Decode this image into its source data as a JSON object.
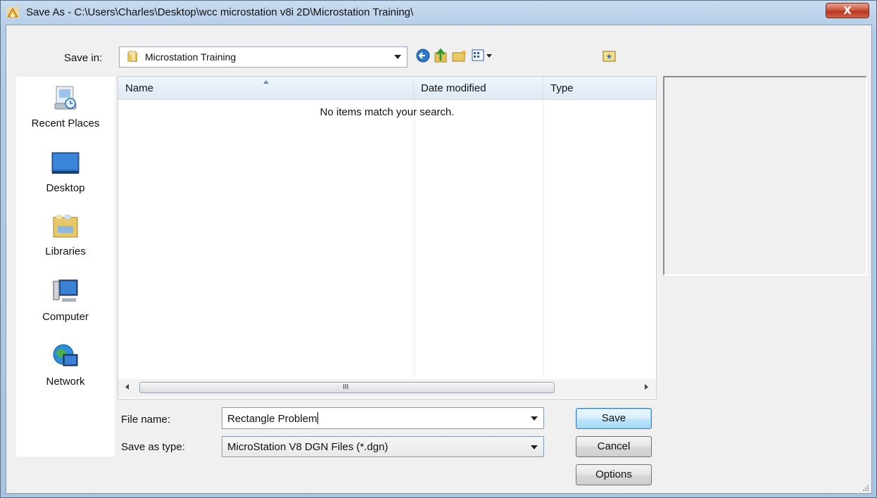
{
  "window": {
    "title": "Save As - C:\\Users\\Charles\\Desktop\\wcc microstation v8i 2D\\Microstation Training\\",
    "close_glyph": "X"
  },
  "savein": {
    "label": "Save in:",
    "value": "Microstation Training"
  },
  "toolbar": {
    "icons": [
      "back-icon",
      "up-folder-icon",
      "new-folder-icon",
      "view-menu-icon",
      "extra-folder-icon"
    ]
  },
  "places": [
    {
      "label": "Recent Places",
      "icon": "recent-places-icon"
    },
    {
      "label": "Desktop",
      "icon": "desktop-icon"
    },
    {
      "label": "Libraries",
      "icon": "libraries-icon"
    },
    {
      "label": "Computer",
      "icon": "computer-icon"
    },
    {
      "label": "Network",
      "icon": "network-icon"
    }
  ],
  "filelist": {
    "columns": [
      "Name",
      "Date modified",
      "Type"
    ],
    "empty_message": "No items match your search.",
    "scroll_grip": "III"
  },
  "form": {
    "filename_label": "File name:",
    "filename_value": "Rectangle Problem",
    "type_label": "Save as type:",
    "type_value": "MicroStation V8 DGN Files (*.dgn)"
  },
  "buttons": {
    "save": "Save",
    "cancel": "Cancel",
    "options": "Options"
  },
  "colors": {
    "title_gradient": "#b4cce6",
    "close_red": "#c9503a",
    "default_button": "#bee6fd"
  }
}
